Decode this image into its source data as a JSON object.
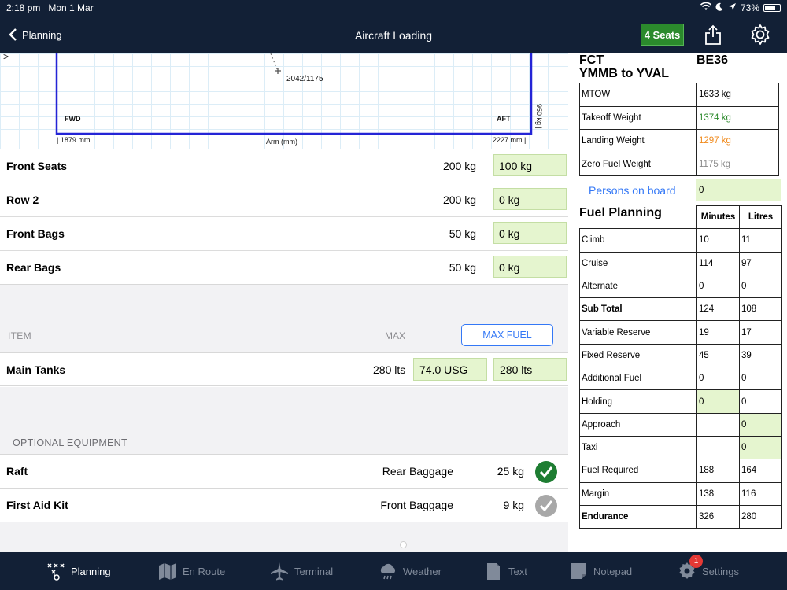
{
  "status": {
    "time": "2:18 pm",
    "date": "Mon 1 Mar",
    "battery": "73%",
    "battery_level": 0.73
  },
  "nav": {
    "back_label": "Planning",
    "title": "Aircraft Loading",
    "seats_label": "4 Seats"
  },
  "chart": {
    "point_label": "2042/1175",
    "fwd_label": "FWD",
    "aft_label": "AFT",
    "arm_min": "| 1879 mm",
    "arm_max": "2227 mm |",
    "xlabel": "Arm (mm)",
    "weight_label": "950 kg |",
    "arrow": ">"
  },
  "loads": [
    {
      "label": "Front Seats",
      "max": "200 kg",
      "value": "100 kg"
    },
    {
      "label": "Row 2",
      "max": "200 kg",
      "value": "0 kg"
    },
    {
      "label": "Front Bags",
      "max": "50 kg",
      "value": "0 kg"
    },
    {
      "label": "Rear Bags",
      "max": "50 kg",
      "value": "0 kg"
    }
  ],
  "fuel_section": {
    "item_header": "ITEM",
    "max_header": "MAX",
    "max_fuel_button": "MAX FUEL",
    "tank_label": "Main Tanks",
    "tank_max": "280 lts",
    "usg_value": "74.0 USG",
    "litres_value": "280 lts"
  },
  "optional": {
    "header": "OPTIONAL EQUIPMENT",
    "items": [
      {
        "label": "Raft",
        "location": "Rear Baggage",
        "weight": "25 kg",
        "checked": true
      },
      {
        "label": "First Aid Kit",
        "location": "Front Baggage",
        "weight": "9 kg",
        "checked": false
      }
    ]
  },
  "summary": {
    "fct": "FCT",
    "route": "YMMB to YVAL",
    "aircraft": "BE36",
    "weights": [
      {
        "label": "MTOW",
        "value": "1633 kg",
        "color": "#000000"
      },
      {
        "label": "Takeoff Weight",
        "value": "1374 kg",
        "color": "#2e8b2e"
      },
      {
        "label": "Landing Weight",
        "value": "1297 kg",
        "color": "#f08a1c"
      },
      {
        "label": "Zero Fuel Weight",
        "value": "1175 kg",
        "color": "#8a8a8a"
      }
    ],
    "persons_label": "Persons on board",
    "persons_value": "0"
  },
  "fuel_planning": {
    "title": "Fuel Planning",
    "col_minutes": "Minutes",
    "col_litres": "Litres",
    "rows": [
      {
        "label": "Climb",
        "minutes": "10",
        "litres": "11"
      },
      {
        "label": "Cruise",
        "minutes": "114",
        "litres": "97"
      },
      {
        "label": "Alternate",
        "minutes": "0",
        "litres": "0"
      },
      {
        "label": "Sub Total",
        "minutes": "124",
        "litres": "108",
        "bold": true
      },
      {
        "label": "Variable Reserve",
        "minutes": "19",
        "litres": "17"
      },
      {
        "label": "Fixed Reserve",
        "minutes": "45",
        "litres": "39"
      },
      {
        "label": "Additional Fuel",
        "minutes": "0",
        "litres": "0"
      },
      {
        "label": "Holding",
        "minutes": "0",
        "litres": "0",
        "minutes_input": true
      },
      {
        "label": "Approach",
        "minutes": "",
        "litres": "0",
        "litres_input": true
      },
      {
        "label": "Taxi",
        "minutes": "",
        "litres": "0",
        "litres_input": true
      },
      {
        "label": "Fuel Required",
        "minutes": "188",
        "litres": "164"
      },
      {
        "label": "Margin",
        "minutes": "138",
        "litres": "116"
      },
      {
        "label": "Endurance",
        "minutes": "326",
        "litres": "280",
        "bold": true
      }
    ]
  },
  "tabs": [
    {
      "label": "Planning",
      "icon": "planning-icon",
      "active": true
    },
    {
      "label": "En Route",
      "icon": "map-icon"
    },
    {
      "label": "Terminal",
      "icon": "plane-icon"
    },
    {
      "label": "Weather",
      "icon": "weather-icon"
    },
    {
      "label": "Text",
      "icon": "document-icon"
    },
    {
      "label": "Notepad",
      "icon": "notepad-icon"
    },
    {
      "label": "Settings",
      "icon": "gear-icon",
      "badge": "1"
    }
  ]
}
